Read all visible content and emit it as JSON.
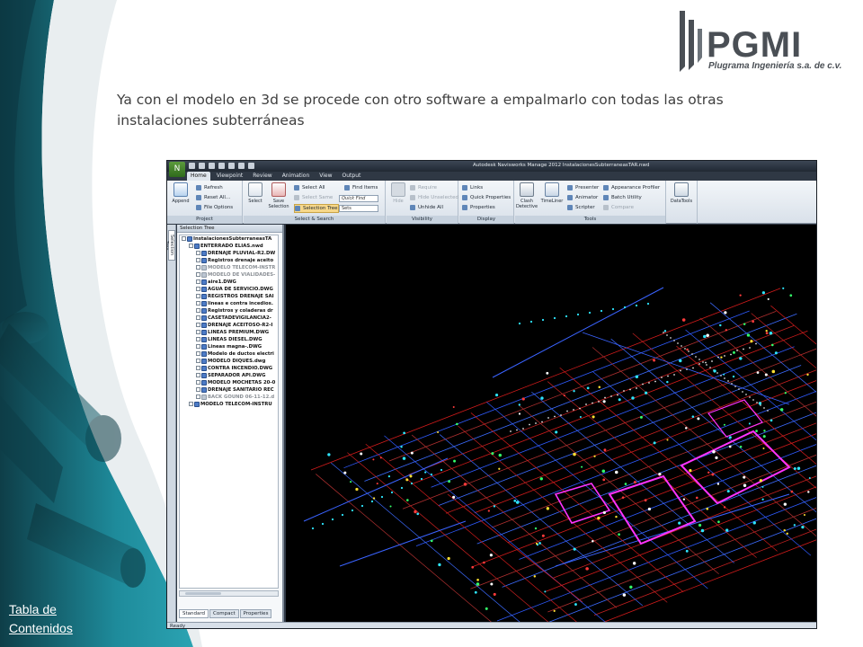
{
  "headline": "Ya con el modelo en 3d se procede con otro software a empalmarlo con todas las otras instalaciones subterráneas",
  "link": "Tabla de Contenidos",
  "logo": {
    "name": "PGMI",
    "tagline": "Plugrama Ingeniería s.a. de c.v."
  },
  "colors": {
    "teal": "#1e8b9b",
    "dark_teal": "#0f4f5b",
    "logo_gray": "#4a4f55",
    "viewport_bg": "#000000"
  },
  "app": {
    "title": "Autodesk Navisworks Manage 2012   InstalacionesSubterraneasTAR.nwd",
    "tabs": [
      "Home",
      "Viewpoint",
      "Review",
      "Animation",
      "View",
      "Output"
    ],
    "active_tab": "Home",
    "ribbon": {
      "project": {
        "label": "Project",
        "append": "Append",
        "refresh": "Refresh",
        "reset_all": "Reset All...",
        "file_options": "File Options"
      },
      "select_search": {
        "label": "Select & Search",
        "select": "Select",
        "save_selection": "Save Selection",
        "select_all": "Select All",
        "select_same": "Select Same",
        "selection_tree": "Selection Tree",
        "find_items": "Find Items",
        "quick_find": "Quick Find",
        "sets": "Sets"
      },
      "visibility": {
        "label": "Visibility",
        "hide": "Hide",
        "require": "Require",
        "hide_unselected": "Hide Unselected",
        "unhide_all": "Unhide All"
      },
      "display": {
        "label": "Display",
        "links": "Links",
        "quick_properties": "Quick Properties",
        "properties": "Properties"
      },
      "tools": {
        "label": "Tools",
        "clash_detective": "Clash Detective",
        "timeliner": "TimeLiner",
        "presenter": "Presenter",
        "animator": "Animator",
        "scripter": "Scripter",
        "appearance_profiler": "Appearance Profiler",
        "batch_utility": "Batch Utility",
        "compare": "Compare"
      },
      "datatools": "DataTools"
    },
    "panel": {
      "side_tab": "Selection Tree",
      "header": "Selection Tree",
      "items": [
        {
          "label": "InstalacionesSubterraneasTA",
          "depth": 0,
          "dim": false
        },
        {
          "label": "ENTERRADO ELIAS.nwd",
          "depth": 1,
          "dim": false
        },
        {
          "label": "DRENAJE PLUVIAL-R2.DW",
          "depth": 2,
          "dim": false
        },
        {
          "label": "Registros drenaje aceito",
          "depth": 2,
          "dim": false
        },
        {
          "label": "MODELO TELECOM-INSTR",
          "depth": 2,
          "dim": true
        },
        {
          "label": "MODELO DE VIALIDADES-",
          "depth": 2,
          "dim": true
        },
        {
          "label": "aire1.DWG",
          "depth": 2,
          "dim": false
        },
        {
          "label": "AGUA DE SERVICIO.DWG",
          "depth": 2,
          "dim": false
        },
        {
          "label": "REGISTROS DRENAJE SAI",
          "depth": 2,
          "dim": false
        },
        {
          "label": "lineas e contra incedios.",
          "depth": 2,
          "dim": false
        },
        {
          "label": "Registros y coladeras dr",
          "depth": 2,
          "dim": false
        },
        {
          "label": "CASETADEVIGILANCIA2-",
          "depth": 2,
          "dim": false
        },
        {
          "label": "DRENAJE ACEITOSO-R2-I",
          "depth": 2,
          "dim": false
        },
        {
          "label": "LINEAS PREMIUM.DWG",
          "depth": 2,
          "dim": false
        },
        {
          "label": "LINEAS DIESEL.DWG",
          "depth": 2,
          "dim": false
        },
        {
          "label": "Lineas magna-.DWG",
          "depth": 2,
          "dim": false
        },
        {
          "label": "Modelo de ductos electri",
          "depth": 2,
          "dim": false
        },
        {
          "label": "MODELO DIQUES.dwg",
          "depth": 2,
          "dim": false
        },
        {
          "label": "CONTRA INCENDIO.DWG",
          "depth": 2,
          "dim": false
        },
        {
          "label": "SEPARADOR API.DWG",
          "depth": 2,
          "dim": false
        },
        {
          "label": "MODELO MOCHETAS 20-0",
          "depth": 2,
          "dim": false
        },
        {
          "label": "DRENAJE SANITARIO REC",
          "depth": 2,
          "dim": false
        },
        {
          "label": "BACK GOUND 06-11-12.d",
          "depth": 2,
          "dim": true
        },
        {
          "label": "MODELO TELECOM-INSTRU",
          "depth": 1,
          "dim": false
        }
      ],
      "tabs": [
        "Standard",
        "Compact",
        "Properties"
      ],
      "active_tab": "Standard"
    },
    "status": "Ready"
  }
}
